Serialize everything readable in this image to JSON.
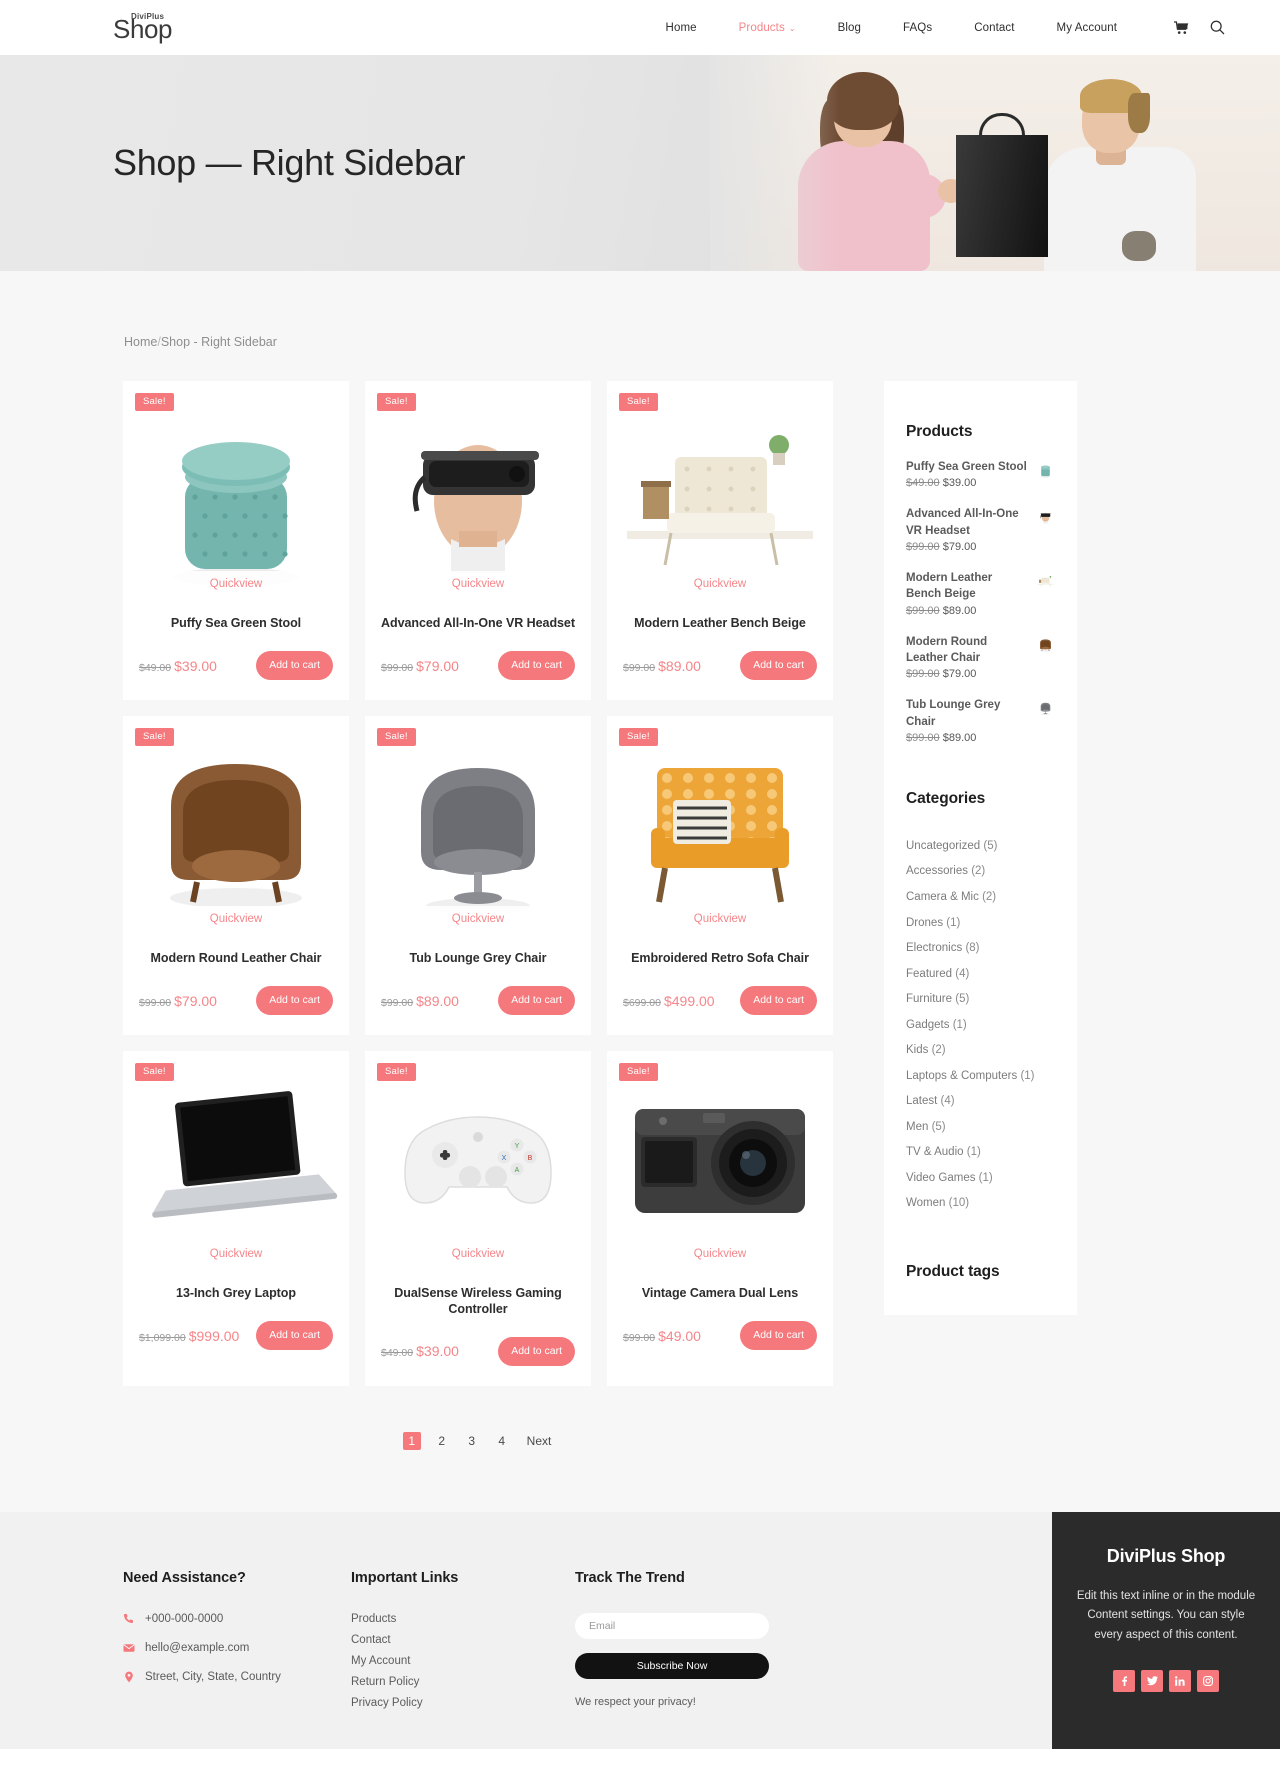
{
  "header": {
    "logo_sup": "DiviPlus",
    "logo_main": "Shop",
    "nav": [
      {
        "label": "Home",
        "active": false,
        "caret": false
      },
      {
        "label": "Products",
        "active": true,
        "caret": true
      },
      {
        "label": "Blog",
        "active": false,
        "caret": false
      },
      {
        "label": "FAQs",
        "active": false,
        "caret": false
      },
      {
        "label": "Contact",
        "active": false,
        "caret": false
      },
      {
        "label": "My Account",
        "active": false,
        "caret": false
      }
    ],
    "cart_icon": "shopping-cart-icon",
    "search_icon": "search-icon",
    "caret_glyph": "⌄"
  },
  "hero": {
    "title": "Shop — Right Sidebar"
  },
  "breadcrumb": {
    "home": "Home",
    "slash": "/",
    "current": "Shop",
    "sep": " - ",
    "page": "Right Sidebar"
  },
  "products": [
    {
      "title": "Puffy Sea Green Stool",
      "old_price": "$49.00",
      "new_price": "$39.00",
      "badge": "Sale!",
      "quickview": "Quickview",
      "add": "Add to cart",
      "image": "stool-sea-green"
    },
    {
      "title": "Advanced All-In-One VR Headset",
      "old_price": "$99.00",
      "new_price": "$79.00",
      "badge": "Sale!",
      "quickview": "Quickview",
      "add": "Add to cart",
      "image": "vr-headset"
    },
    {
      "title": "Modern Leather Bench Beige",
      "old_price": "$99.00",
      "new_price": "$89.00",
      "badge": "Sale!",
      "quickview": "Quickview",
      "add": "Add to cart",
      "image": "bench-beige"
    },
    {
      "title": "Modern Round Leather Chair",
      "old_price": "$99.00",
      "new_price": "$79.00",
      "badge": "Sale!",
      "quickview": "Quickview",
      "add": "Add to cart",
      "image": "round-leather-chair"
    },
    {
      "title": "Tub Lounge Grey Chair",
      "old_price": "$99.00",
      "new_price": "$89.00",
      "badge": "Sale!",
      "quickview": "Quickview",
      "add": "Add to cart",
      "image": "tub-lounge-chair"
    },
    {
      "title": "Embroidered Retro Sofa Chair",
      "old_price": "$699.00",
      "new_price": "$499.00",
      "badge": "Sale!",
      "quickview": "Quickview",
      "add": "Add to cart",
      "image": "retro-sofa-chair"
    },
    {
      "title": "13-Inch Grey Laptop",
      "old_price": "$1,099.00",
      "new_price": "$999.00",
      "badge": "Sale!",
      "quickview": "Quickview",
      "add": "Add to cart",
      "image": "laptop"
    },
    {
      "title": "DualSense Wireless Gaming Controller",
      "old_price": "$49.00",
      "new_price": "$39.00",
      "badge": "Sale!",
      "quickview": "Quickview",
      "add": "Add to cart",
      "image": "game-controller"
    },
    {
      "title": "Vintage Camera Dual Lens",
      "old_price": "$99.00",
      "new_price": "$49.00",
      "badge": "Sale!",
      "quickview": "Quickview",
      "add": "Add to cart",
      "image": "vintage-camera"
    }
  ],
  "pagination": {
    "pages": [
      "1",
      "2",
      "3",
      "4"
    ],
    "current": "1",
    "next": "Next"
  },
  "sidebar": {
    "products_heading": "Products",
    "products": [
      {
        "name": "Puffy Sea Green Stool",
        "old_price": "$49.00",
        "new_price": "$39.00",
        "image": "stool-sea-green"
      },
      {
        "name": "Advanced All-In-One VR Headset",
        "old_price": "$99.00",
        "new_price": "$79.00",
        "image": "vr-headset"
      },
      {
        "name": "Modern Leather Bench Beige",
        "old_price": "$99.00",
        "new_price": "$89.00",
        "image": "bench-beige"
      },
      {
        "name": "Modern Round Leather Chair",
        "old_price": "$99.00",
        "new_price": "$79.00",
        "image": "round-leather-chair"
      },
      {
        "name": "Tub Lounge Grey Chair",
        "old_price": "$99.00",
        "new_price": "$89.00",
        "image": "tub-lounge-chair"
      }
    ],
    "categories_heading": "Categories",
    "categories": [
      {
        "label": "Uncategorized",
        "count": "(5)"
      },
      {
        "label": "Accessories",
        "count": "(2)"
      },
      {
        "label": "Camera & Mic",
        "count": "(2)"
      },
      {
        "label": "Drones",
        "count": "(1)"
      },
      {
        "label": "Electronics",
        "count": "(8)"
      },
      {
        "label": "Featured",
        "count": "(4)"
      },
      {
        "label": "Furniture",
        "count": "(5)"
      },
      {
        "label": "Gadgets",
        "count": "(1)"
      },
      {
        "label": "Kids",
        "count": "(2)"
      },
      {
        "label": "Laptops & Computers",
        "count": "(1)"
      },
      {
        "label": "Latest",
        "count": "(4)"
      },
      {
        "label": "Men",
        "count": "(5)"
      },
      {
        "label": "TV & Audio",
        "count": "(1)"
      },
      {
        "label": "Video Games",
        "count": "(1)"
      },
      {
        "label": "Women",
        "count": "(10)"
      }
    ],
    "tags_heading": "Product tags"
  },
  "footer": {
    "assistance_heading": "Need Assistance?",
    "phone": "+000-000-0000",
    "email": "hello@example.com",
    "address": "Street, City, State, Country",
    "links_heading": "Important Links",
    "links": [
      "Products",
      "Contact",
      "My Account",
      "Return Policy",
      "Privacy Policy"
    ],
    "newsletter_heading": "Track The Trend",
    "email_placeholder": "Email",
    "email_value": "",
    "subscribe_label": "Subscribe Now",
    "privacy_note": "We respect your privacy!",
    "panel_title": "DiviPlus Shop",
    "panel_text": "Edit this text inline or in the module Content settings. You can style every aspect of this content.",
    "social": [
      "facebook-icon",
      "twitter-icon",
      "linkedin-icon",
      "instagram-icon"
    ]
  },
  "colors": {
    "accent": "#f4787c",
    "accent_light": "#f4868a",
    "dark": "#2b2b2b",
    "page_bg": "#f7f7f7",
    "footer_bg": "#f1f1f1"
  }
}
